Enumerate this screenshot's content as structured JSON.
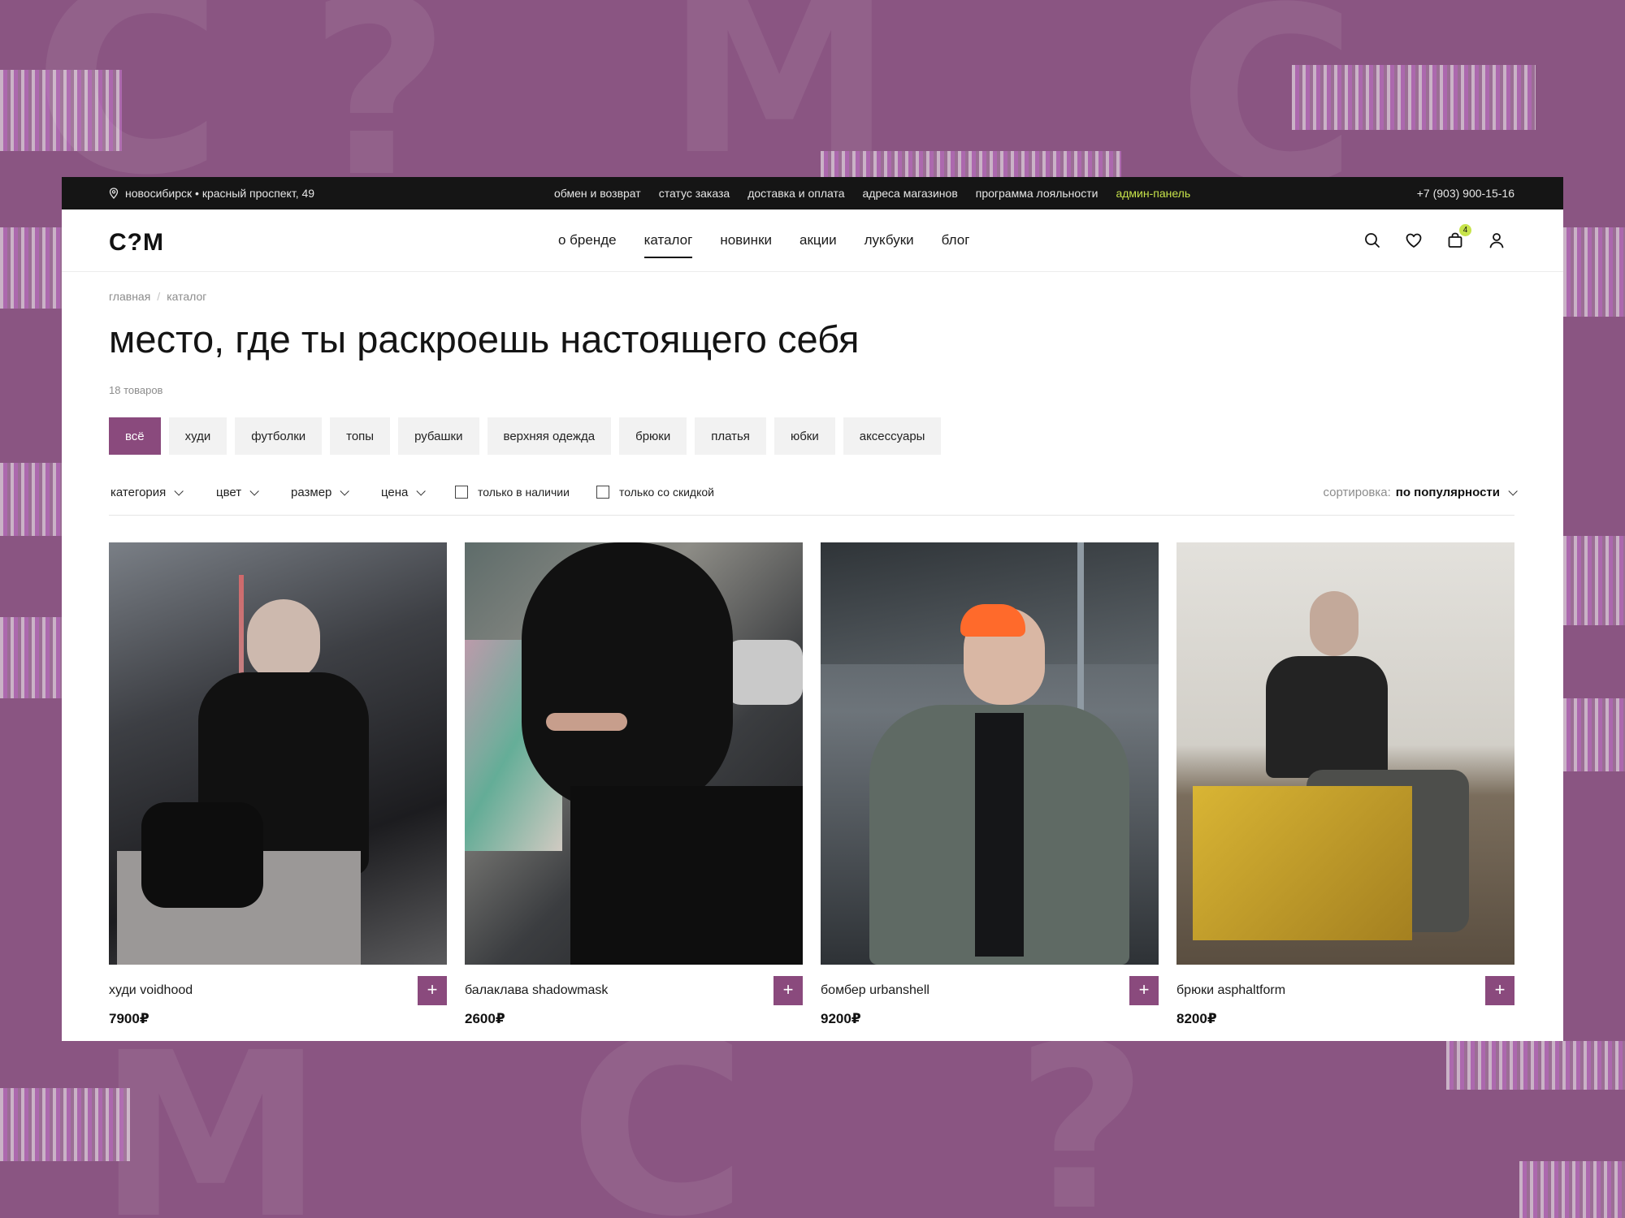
{
  "topbar": {
    "address": "новосибирск • красный проспект, 49",
    "links": [
      "обмен и возврат",
      "статус заказа",
      "доставка и оплата",
      "адреса магазинов",
      "программа лояльности"
    ],
    "admin_link": "админ-панель",
    "phone": "+7 (903) 900-15-16"
  },
  "header": {
    "logo": "C?M",
    "nav": [
      "о бренде",
      "каталог",
      "новинки",
      "акции",
      "лукбуки",
      "блог"
    ],
    "active_nav": "каталог",
    "cart_count": "4"
  },
  "breadcrumb": {
    "home": "главная",
    "separator": "/",
    "current": "каталог"
  },
  "page": {
    "title": "место, где ты раскроешь настоящего себя",
    "count": "18 товаров"
  },
  "categories": [
    "всё",
    "худи",
    "футболки",
    "топы",
    "рубашки",
    "верхняя одежда",
    "брюки",
    "платья",
    "юбки",
    "аксессуары"
  ],
  "active_category": "всё",
  "filters": {
    "dropdowns": [
      "категория",
      "цвет",
      "размер",
      "цена"
    ],
    "checkboxes": [
      "только в наличии",
      "только со скидкой"
    ],
    "sort_label": "сортировка:",
    "sort_value": "по популярности"
  },
  "products": [
    {
      "name": "худи voidhood",
      "price": "7900₽",
      "add": "+"
    },
    {
      "name": "балаклава shadowmask",
      "price": "2600₽",
      "add": "+"
    },
    {
      "name": "бомбер urbanshell",
      "price": "9200₽",
      "add": "+"
    },
    {
      "name": "брюки asphaltform",
      "price": "8200₽",
      "add": "+"
    }
  ],
  "colors": {
    "accent": "#8a4a7d",
    "badge": "#c7e34a",
    "topbar": "#151515",
    "background": "#8a5582"
  }
}
